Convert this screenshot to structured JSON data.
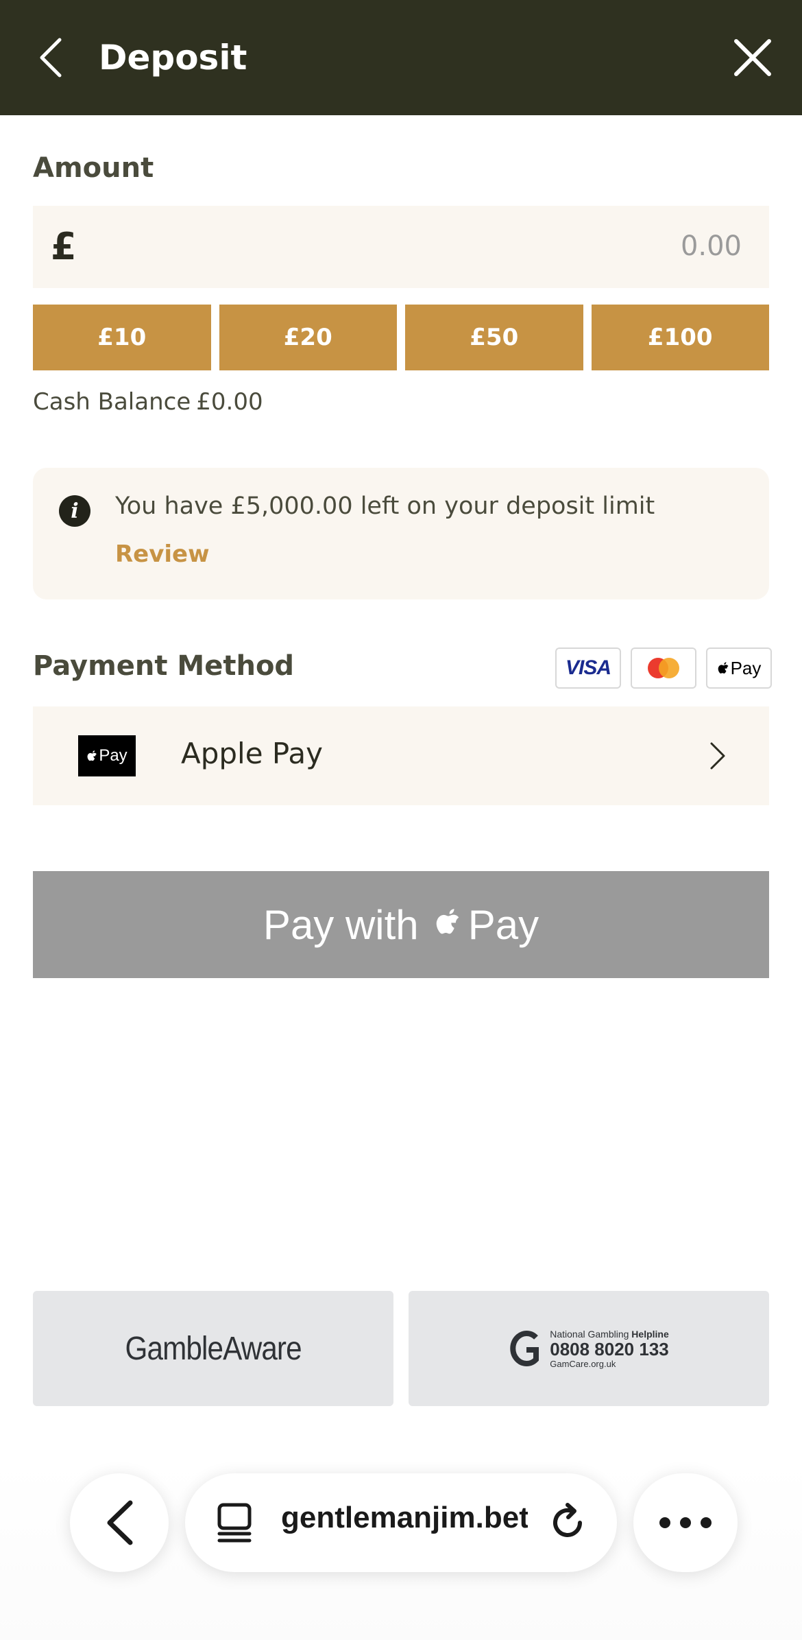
{
  "header": {
    "title": "Deposit"
  },
  "amount": {
    "label": "Amount",
    "currency_symbol": "£",
    "value": "0.00",
    "presets": [
      "£10",
      "£20",
      "£50",
      "£100"
    ]
  },
  "balance": {
    "label": "Cash Balance",
    "value": "£0.00"
  },
  "info": {
    "message": "You have £5,000.00 left on your deposit limit",
    "link_label": "Review"
  },
  "payment": {
    "label": "Payment Method",
    "accepted": [
      "VISA",
      "Mastercard",
      "Apple Pay"
    ],
    "selected": {
      "name": "Apple Pay",
      "badge": "Pay"
    }
  },
  "pay_button": {
    "prefix": "Pay with",
    "suffix": "Pay"
  },
  "footer": {
    "gambleaware": "GambleAware",
    "helpline": {
      "line1": "National Gambling",
      "line1_bold": "Helpline",
      "number": "0808 8020 133",
      "site": "GamCare.org.uk"
    }
  },
  "browser": {
    "url": "gentlemanjim.bet"
  },
  "colors": {
    "header_bg": "#2f3120",
    "accent": "#c79344",
    "field_bg": "#faf6f0",
    "disabled_button": "#9a9a9a"
  }
}
